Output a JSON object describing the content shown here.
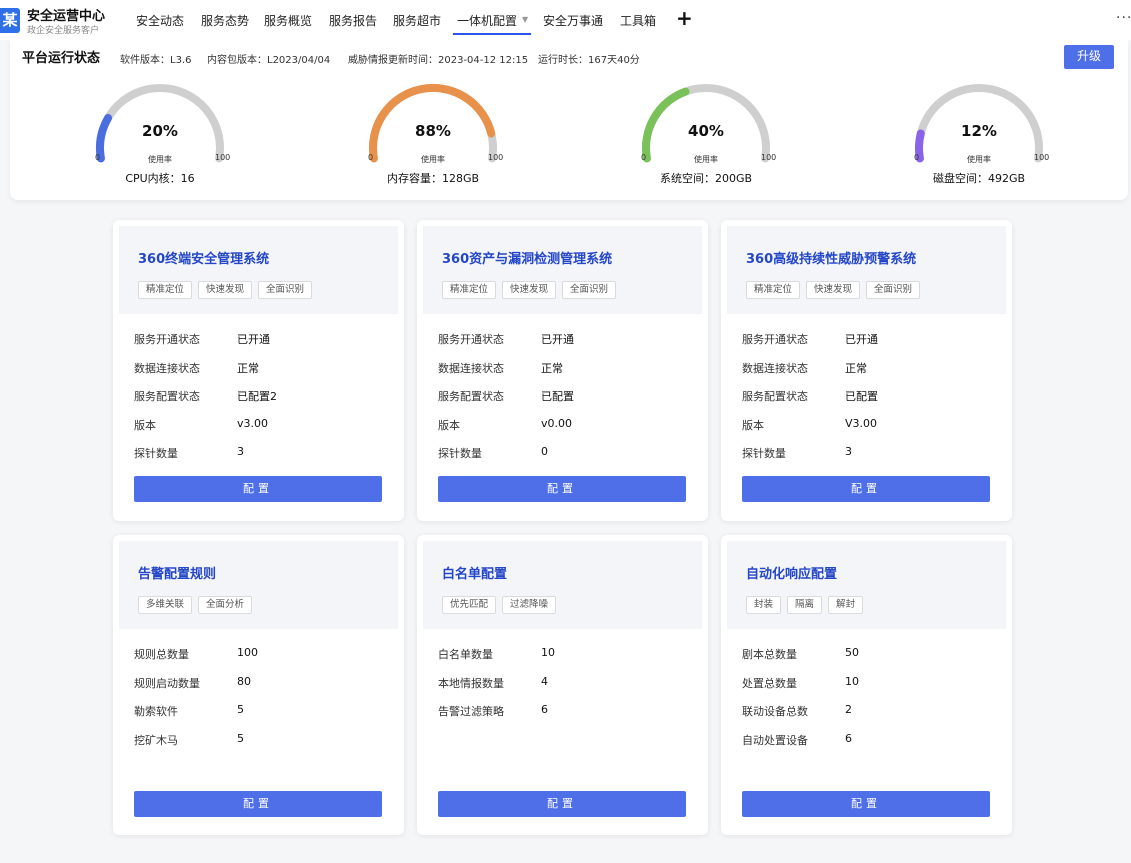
{
  "header": {
    "logo_char": "某",
    "brand_title": "安全运营中心",
    "brand_sub": "政企安全服务客户",
    "nav": [
      "安全动态",
      "服务态势",
      "服务概览",
      "服务报告",
      "服务超市",
      "一体机配置",
      "安全万事通",
      "工具箱"
    ],
    "active_nav": "一体机配置",
    "add_icon": "plus-icon",
    "more_icon": "more-icon"
  },
  "status": {
    "title": "平台运行状态",
    "software_version": "软件版本：L3.6",
    "content_version": "内容包版本：L2023/04/04",
    "intel_update": "威胁情报更新时间：2023-04-12 12:15",
    "uptime": "运行时长：167天40分",
    "upgrade_label": "升级",
    "gauges": [
      {
        "percent": 20,
        "percent_label": "20%",
        "min": "0",
        "max": "100",
        "use_label": "使用率",
        "caption": "CPU内核：16",
        "color": "#4a6ee0"
      },
      {
        "percent": 88,
        "percent_label": "88%",
        "min": "0",
        "max": "100",
        "use_label": "使用率",
        "caption": "内存容量：128GB",
        "color": "#e8914a"
      },
      {
        "percent": 40,
        "percent_label": "40%",
        "min": "0",
        "max": "100",
        "use_label": "使用率",
        "caption": "系统空间：200GB",
        "color": "#7ac15a"
      },
      {
        "percent": 12,
        "percent_label": "12%",
        "min": "0",
        "max": "100",
        "use_label": "使用率",
        "caption": "磁盘空间：492GB",
        "color": "#8a63e8"
      }
    ]
  },
  "cards": [
    {
      "title": "360终端安全管理系统",
      "tags": [
        "精准定位",
        "快速发现",
        "全面识别"
      ],
      "rows": [
        {
          "label": "服务开通状态",
          "value": "已开通"
        },
        {
          "label": "数据连接状态",
          "value": "正常"
        },
        {
          "label": "服务配置状态",
          "value": "已配置2"
        },
        {
          "label": "版本",
          "value": "v3.00"
        },
        {
          "label": "探针数量",
          "value": "3"
        }
      ],
      "button": "配置"
    },
    {
      "title": "360资产与漏洞检测管理系统",
      "tags": [
        "精准定位",
        "快速发现",
        "全面识别"
      ],
      "rows": [
        {
          "label": "服务开通状态",
          "value": "已开通"
        },
        {
          "label": "数据连接状态",
          "value": "正常"
        },
        {
          "label": "服务配置状态",
          "value": "已配置"
        },
        {
          "label": "版本",
          "value": "v0.00"
        },
        {
          "label": "探针数量",
          "value": "0"
        }
      ],
      "button": "配置"
    },
    {
      "title": "360高级持续性威胁预警系统",
      "tags": [
        "精准定位",
        "快速发现",
        "全面识别"
      ],
      "rows": [
        {
          "label": "服务开通状态",
          "value": "已开通"
        },
        {
          "label": "数据连接状态",
          "value": "正常"
        },
        {
          "label": "服务配置状态",
          "value": "已配置"
        },
        {
          "label": "版本",
          "value": "V3.00"
        },
        {
          "label": "探针数量",
          "value": "3"
        }
      ],
      "button": "配置"
    },
    {
      "title": "告警配置规则",
      "tags": [
        "多维关联",
        "全面分析"
      ],
      "rows": [
        {
          "label": "规则总数量",
          "value": "100"
        },
        {
          "label": "规则启动数量",
          "value": "80"
        },
        {
          "label": "勒索软件",
          "value": "5"
        },
        {
          "label": "挖矿木马",
          "value": "5"
        }
      ],
      "button": "配置"
    },
    {
      "title": "白名单配置",
      "tags": [
        "优先匹配",
        "过滤降噪"
      ],
      "rows": [
        {
          "label": "白名单数量",
          "value": "10"
        },
        {
          "label": "本地情报数量",
          "value": "4"
        },
        {
          "label": "告警过滤策略",
          "value": "6"
        }
      ],
      "button": "配置"
    },
    {
      "title": "自动化响应配置",
      "tags": [
        "封装",
        "隔离",
        "解封"
      ],
      "rows": [
        {
          "label": "剧本总数量",
          "value": "50"
        },
        {
          "label": "处置总数量",
          "value": "10"
        },
        {
          "label": "联动设备总数",
          "value": "2"
        },
        {
          "label": "自动处置设备",
          "value": "6"
        }
      ],
      "button": "配置"
    }
  ]
}
